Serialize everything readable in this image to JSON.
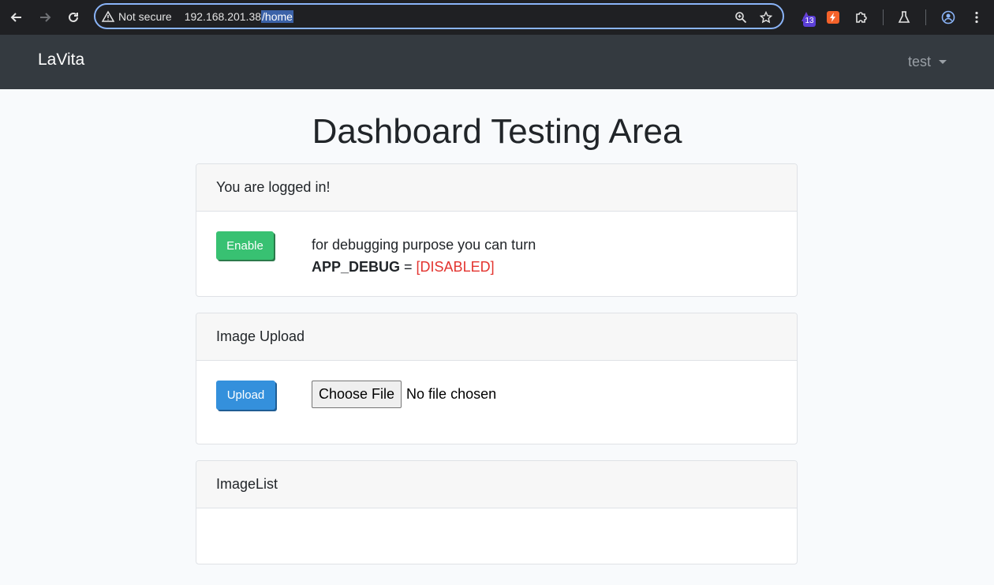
{
  "browser": {
    "security_label": "Not secure",
    "url_host": "192.168.201.38",
    "url_path": "/home",
    "extension_badge": "13"
  },
  "navbar": {
    "brand": "LaVita",
    "user": "test"
  },
  "page": {
    "title": "Dashboard Testing Area"
  },
  "cards": {
    "status": {
      "header": "You are logged in!",
      "button": "Enable",
      "debug_line1": "for debugging purpose you can turn",
      "debug_key": "APP_DEBUG",
      "debug_eq": " = ",
      "debug_status": "[DISABLED]"
    },
    "upload": {
      "header": "Image Upload",
      "button": "Upload",
      "choose_file": "Choose File",
      "file_status": "No file chosen"
    },
    "list": {
      "header": "ImageList"
    }
  },
  "colors": {
    "enable": "#38c172",
    "upload": "#3490dc",
    "disabled": "#e3342f",
    "navbar": "#343a40"
  }
}
